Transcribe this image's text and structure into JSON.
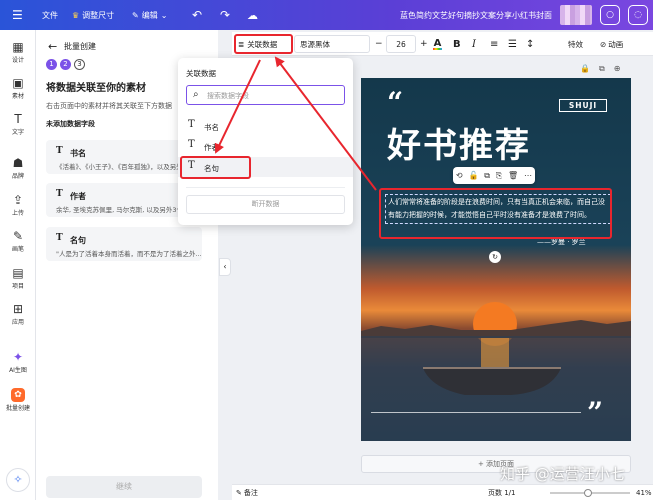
{
  "topbar": {
    "menu_icon": "☰",
    "file": "文件",
    "resize": "调整尺寸",
    "edit": "编辑",
    "title": "蓝色简约文艺好句摘抄文案分享小红书封面"
  },
  "rail": {
    "items": [
      {
        "icon": "▦",
        "label": "设计"
      },
      {
        "icon": "▣",
        "label": "素材"
      },
      {
        "icon": "T",
        "label": "文字"
      },
      {
        "icon": "☗",
        "label": "品牌"
      },
      {
        "icon": "⇪",
        "label": "上传"
      },
      {
        "icon": "✎",
        "label": "画笔"
      },
      {
        "icon": "▤",
        "label": "项目"
      },
      {
        "icon": "⊞",
        "label": "应用"
      },
      {
        "icon": "✦",
        "label": "AI生图"
      },
      {
        "icon": "✿",
        "label": "批量创建"
      }
    ],
    "spark_icon": "✧"
  },
  "panel": {
    "back_icon": "←",
    "title": "批量创建",
    "steps": [
      "1",
      "2",
      "3"
    ],
    "heading": "将数据关联至你的素材",
    "desc": "右击页面中的素材并将其关联至下方数据",
    "subheading": "未添加数据字段",
    "fields": [
      {
        "icon": "T",
        "name": "书名",
        "sample": "《活着》、《小王子》、《百年孤独》，以及另外"
      },
      {
        "icon": "T",
        "name": "作者",
        "sample": "余华, 圣埃克苏佩里, 马尔克斯, 以及另外3个"
      },
      {
        "icon": "T",
        "name": "名句",
        "sample": "\"人是为了活着本身而活着，而不是为了活着之外..."
      }
    ],
    "continue": "继续",
    "collapse_icon": "‹"
  },
  "toolbar": {
    "link_data": "关联数据",
    "db_icon": "≣",
    "font": "思源黑体",
    "minus": "−",
    "size": "26",
    "plus": "+",
    "color_glyph": "A",
    "bold": "B",
    "italic": "I",
    "align_icon": "≡",
    "list_icon": "☰",
    "spacing_icon": "↕",
    "special": "特效",
    "anim": "动画",
    "anim_icon": "⊘"
  },
  "page_tools": {
    "lock": "🔒",
    "copy": "⧉",
    "add": "⊕"
  },
  "dropdown": {
    "title": "关联数据",
    "search_icon": "⌕",
    "search_placeholder": "搜索数据字段",
    "items": [
      {
        "icon": "T",
        "label": "书名"
      },
      {
        "icon": "T",
        "label": "作者"
      },
      {
        "icon": "T",
        "label": "名句"
      }
    ],
    "disconnect": "断开数据"
  },
  "canvas": {
    "quote_open": "“",
    "tag": "SHUJI",
    "title": "好书推荐",
    "mini_toolbar": [
      "⟲",
      "🔓",
      "⧉",
      "⎘",
      "🗑",
      "⋯"
    ],
    "quote": "人们常常将准备的阶段是在浪费时间，只有当真正机会来临，而自己没有能力把握的时候，才能觉悟自己平时没有准备才是浪费了时间。",
    "author": "——罗曼 · 罗兰",
    "rotate_icon": "↻",
    "quote_close": "”"
  },
  "add_page": "+ 添加页面",
  "bottombar": {
    "notes_icon": "✎",
    "notes": "备注",
    "pages": "页数 1/1",
    "zoom": "41%"
  },
  "watermark": "知乎 @运营汪小七",
  "colors": {
    "accent": "#7b52e8",
    "topbar_start": "#2a54d8",
    "annotation_red": "#e8262e"
  }
}
